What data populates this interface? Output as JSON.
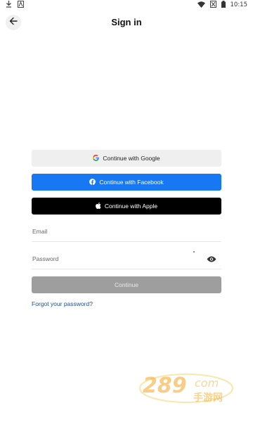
{
  "status_bar": {
    "time": "10:15",
    "icons": [
      "download-icon",
      "notification-icon",
      "wifi-icon",
      "battery-empty-icon",
      "battery-icon"
    ]
  },
  "header": {
    "title": "Sign in",
    "back_icon": "arrow-left-icon"
  },
  "auth_buttons": {
    "google_label": "Continue with Google",
    "facebook_label": "Continue with Facebook",
    "apple_label": "Continue with Apple"
  },
  "form": {
    "email_label": "Email",
    "password_label": "Password",
    "continue_label": "Continue",
    "forgot_label": "Forgot your password?"
  },
  "colors": {
    "facebook": "#1877f2",
    "apple": "#000000",
    "google_bg": "#efefef",
    "continue_disabled": "#9e9e9e",
    "link": "#1a4fa0"
  }
}
